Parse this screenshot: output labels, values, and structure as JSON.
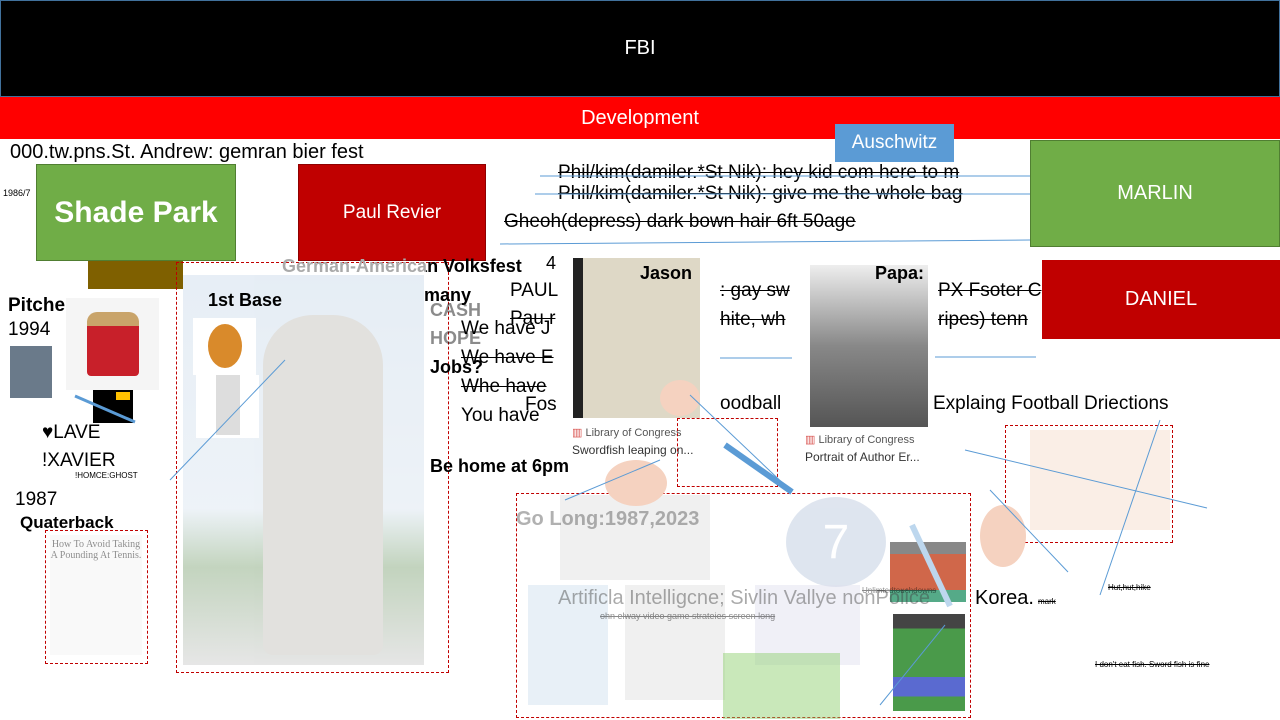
{
  "header": {
    "title": "FBI",
    "subtitle": "Development",
    "tag": "Auschwitz"
  },
  "boxes": {
    "shade_park": "Shade Park",
    "paul_revier": "Paul Revier",
    "marlin": "MARLIN",
    "daniel": "DANIEL"
  },
  "texts": {
    "top_line": "000.tw.pns.St. Andrew: gemran bier fest",
    "date": "1986/7",
    "phil1": "Phil/kim(damiler.*St Nik): hey kid com here to m",
    "phil2": "Phil/kim(damiler.*St Nik): give me the whole bag",
    "gheoh": "Gheoh(depress) dark bown hair 6ft 50age",
    "volksfest": "German-American Volksfest",
    "four": "4",
    "paul": "PAUL",
    "pau": "Pau r",
    "many": "many",
    "cash": "CASH",
    "hope": "HOPE",
    "jobs": "Jobs?",
    "we_have_j": "We have J",
    "we_have_e": "We have E",
    "whe_have": "Whe have",
    "fos": "Fos",
    "you_have": "You have",
    "be_home": "Be home at 6pm",
    "gay": ": gay sw",
    "white": "hite, wh",
    "pxf": "PX Fsoter C",
    "ripes": "ripes) tenn",
    "goodball": "oodball",
    "explaining": "Explaing Football Driections",
    "pitcher": "Pitcher",
    "y1994": "1994",
    "lave": "♥LAVE",
    "xavier": "!XAVIER",
    "homce": "!HOMCE:GHOST",
    "y1987": "1987",
    "quaterback": "Quaterback",
    "first_base": "1st Base",
    "book": "How To Avoid Taking A Pounding At Tennis.",
    "go_long": "Go Long:1987,2023",
    "seven": "7",
    "ai": "Artificla Intelligcne; Sivlin Vallye nonPolice",
    "korea": "Korea.",
    "mark": "mark",
    "unlimited": "Unlimtedtouchdowns",
    "ohn": "ohn elway video game strateies screen long",
    "hut": "Hut,hut,hike",
    "catfish": "I don't eat fish. Sword fish is fine"
  },
  "cards": [
    {
      "name": "Jason",
      "source": "Library of Congress",
      "caption": "Swordfish leaping on..."
    },
    {
      "name": "Papa:",
      "source": "Library of Congress",
      "caption": "Portrait of Author Er..."
    }
  ],
  "colors": {
    "green": "#70ad47",
    "red": "#c00000",
    "blue": "#5b9bd5",
    "brown": "#7f6000"
  }
}
